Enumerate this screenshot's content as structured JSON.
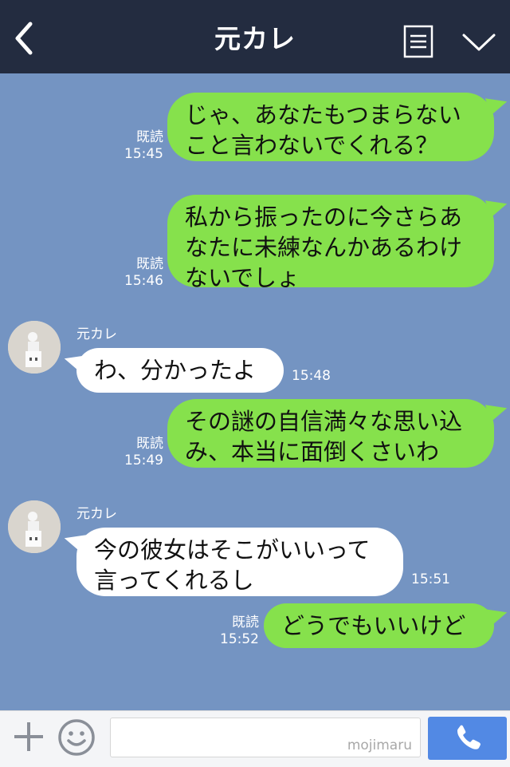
{
  "header": {
    "title": "元カレ"
  },
  "messages": [
    {
      "type": "out",
      "lines": [
        "じゃ、あなたもつまらない",
        "こと言わないでくれる？"
      ],
      "read": "既読",
      "time": "15:45"
    },
    {
      "type": "out",
      "lines": [
        "私から振ったのに今さらあ",
        "なたに未練なんかあるわけ",
        "ないでしょ"
      ],
      "read": "既読",
      "time": "15:46"
    },
    {
      "type": "in",
      "sender": "元カレ",
      "lines": [
        "わ、分かったよ"
      ],
      "time": "15:48"
    },
    {
      "type": "out",
      "lines": [
        "その謎の自信満々な思い込",
        "み、本当に面倒くさいわ"
      ],
      "read": "既読",
      "time": "15:49"
    },
    {
      "type": "in",
      "sender": "元カレ",
      "lines": [
        "今の彼女はそこがいいって",
        "言ってくれるし"
      ],
      "time": "15:51"
    },
    {
      "type": "out",
      "lines": [
        "どうでもいいけど"
      ],
      "read": "既読",
      "time": "15:52"
    }
  ],
  "footer": {
    "watermark": "mojimaru"
  },
  "colors": {
    "background": "#7494c2",
    "header": "#232c40",
    "out_bubble": "#86e14c",
    "in_bubble": "#ffffff",
    "call_button": "#5289e4"
  },
  "icons": [
    "back-arrow-icon",
    "menu-icon",
    "chevron-down-icon",
    "plus-icon",
    "smiley-icon",
    "phone-icon"
  ]
}
